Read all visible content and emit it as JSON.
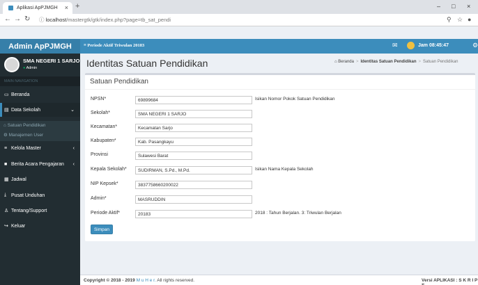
{
  "browser": {
    "tab_title": "Aplikasi ApPJMGH",
    "url_host": "localhost",
    "url_path": "/mastergtk/gtk/index.php?page=tb_sat_pendi"
  },
  "header": {
    "logo": "Admin ApPJMGH",
    "period": "≡ Periode Aktif Triwulan 20183",
    "clock": "Jam 08:45:47"
  },
  "sidebar": {
    "user_name": "SMA NEGERI 1 SARJO",
    "user_status": "Admin",
    "nav_header": "MAIN NAVIGATION",
    "items": [
      {
        "label": "Beranda",
        "icon": "monitor-icon"
      },
      {
        "label": "Data Sekolah",
        "icon": "book-icon"
      },
      {
        "label": "Kelola Master",
        "icon": "database-icon"
      },
      {
        "label": "Berita Acara Pengajaran",
        "icon": "briefcase-icon"
      },
      {
        "label": "Jadwal",
        "icon": "table-icon"
      },
      {
        "label": "Pusat Unduhan",
        "icon": "download-icon"
      },
      {
        "label": "Tentang/Support",
        "icon": "user-icon"
      },
      {
        "label": "Keluar",
        "icon": "signout-icon"
      }
    ],
    "submenu": [
      {
        "label": "Satuan Pendidikan",
        "icon": "bank-icon"
      },
      {
        "label": "Manajemen User",
        "icon": "cogs-icon"
      }
    ]
  },
  "page": {
    "title": "Identitas Satuan Pendidikan",
    "breadcrumb": [
      "Beranda",
      "Identitas Satuan Pendidikan",
      "Satuan Pendidikan"
    ]
  },
  "form": {
    "box_title": "Satuan Pendidikan",
    "fields": [
      {
        "label": "NPSN*",
        "value": "69899684",
        "hint": "Isikan Nomor Pokok Satuan Pendidikan"
      },
      {
        "label": "Sekolah*",
        "value": "SMA NEGERI 1 SARJO",
        "hint": ""
      },
      {
        "label": "Kecamatan*",
        "value": "Kecamatan Sarjo",
        "hint": ""
      },
      {
        "label": "Kabupaten*",
        "value": "Kab. Pasangkayu",
        "hint": ""
      },
      {
        "label": "Provinsi",
        "value": "Sulawesi Barat",
        "hint": ""
      },
      {
        "label": "Kepala Sekolah*",
        "value": "SUDIRMAN, S.Pd., M.Pd.",
        "hint": "Isikan Nama Kepala Sekolah"
      },
      {
        "label": "NIP Kepsek*",
        "value": "3837758660200022",
        "hint": ""
      },
      {
        "label": "Admin*",
        "value": "MASRUDDIN",
        "hint": ""
      },
      {
        "label": "Periode Aktif*",
        "value": "20183",
        "hint": "2018 : Tahun Berjalan. 3: Triwulan Berjalan"
      }
    ],
    "submit_label": "Simpan"
  },
  "footer": {
    "copyright_prefix": "Copyright © 2018 - 2019",
    "author": "M u H e r.",
    "copyright_suffix": "All rights reserved.",
    "version": "Versi APLIKASI : S K R I P S"
  }
}
